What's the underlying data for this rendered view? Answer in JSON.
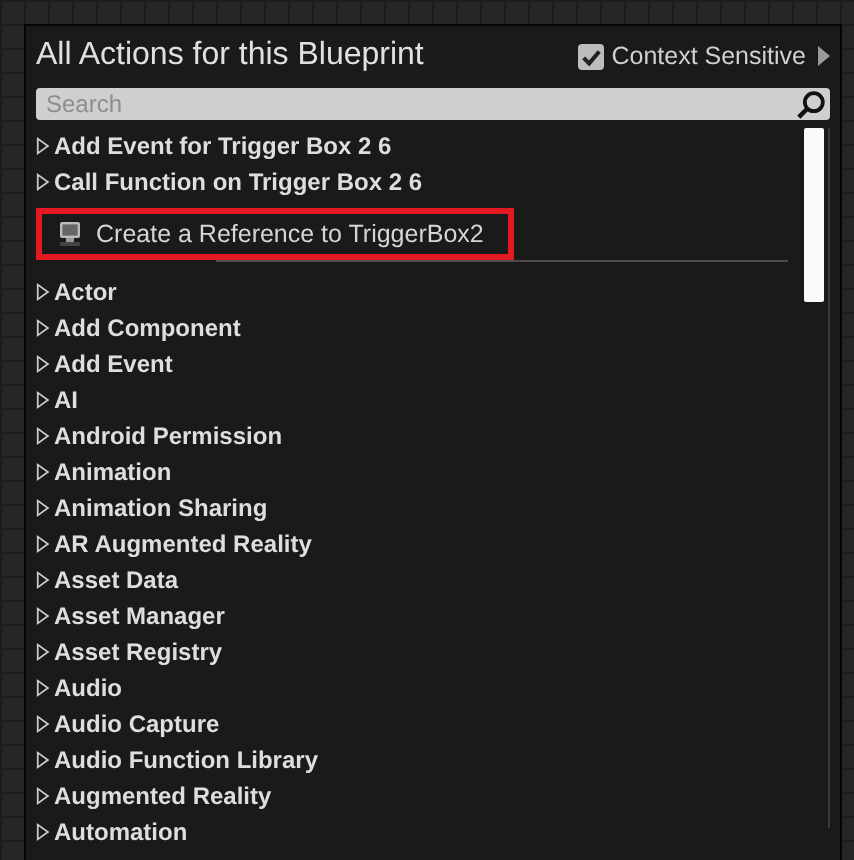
{
  "panel": {
    "title": "All Actions for this Blueprint",
    "context_sensitive": {
      "label": "Context Sensitive",
      "checked": true
    },
    "search": {
      "placeholder": "Search"
    }
  },
  "items": [
    {
      "kind": "category",
      "label": "Add Event for Trigger Box 2 6",
      "expanded": false
    },
    {
      "kind": "category",
      "label": "Call Function on Trigger Box 2 6",
      "expanded": false
    },
    {
      "kind": "action",
      "label": "Create a Reference to TriggerBox2",
      "highlighted": true
    },
    {
      "kind": "category",
      "label": "Actor",
      "expanded": false
    },
    {
      "kind": "category",
      "label": "Add Component",
      "expanded": false
    },
    {
      "kind": "category",
      "label": "Add Event",
      "expanded": false
    },
    {
      "kind": "category",
      "label": "AI",
      "expanded": false
    },
    {
      "kind": "category",
      "label": "Android Permission",
      "expanded": false
    },
    {
      "kind": "category",
      "label": "Animation",
      "expanded": false
    },
    {
      "kind": "category",
      "label": "Animation Sharing",
      "expanded": false
    },
    {
      "kind": "category",
      "label": "AR Augmented Reality",
      "expanded": false
    },
    {
      "kind": "category",
      "label": "Asset Data",
      "expanded": false
    },
    {
      "kind": "category",
      "label": "Asset Manager",
      "expanded": false
    },
    {
      "kind": "category",
      "label": "Asset Registry",
      "expanded": false
    },
    {
      "kind": "category",
      "label": "Audio",
      "expanded": false
    },
    {
      "kind": "category",
      "label": "Audio Capture",
      "expanded": false
    },
    {
      "kind": "category",
      "label": "Audio Function Library",
      "expanded": false
    },
    {
      "kind": "category",
      "label": "Augmented Reality",
      "expanded": false
    },
    {
      "kind": "category",
      "label": "Automation",
      "expanded": false
    }
  ]
}
